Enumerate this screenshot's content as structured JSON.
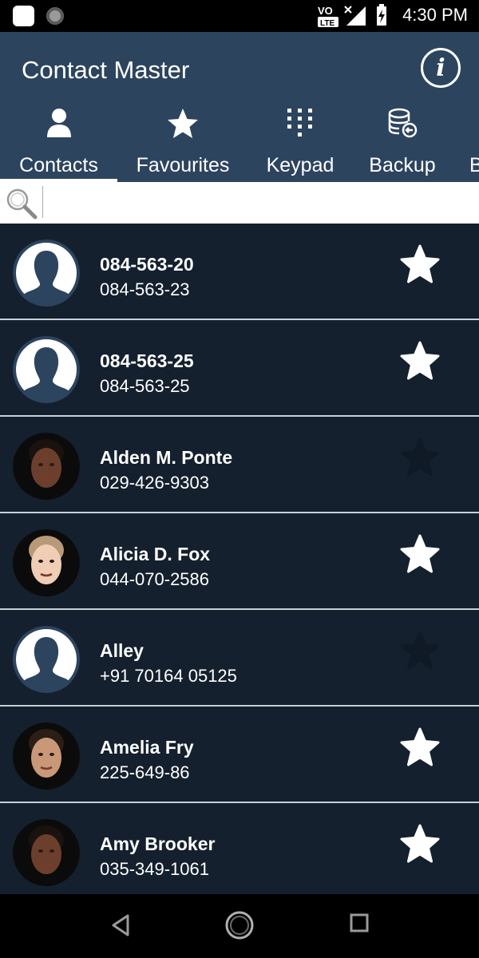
{
  "status_bar": {
    "time": "4:30 PM",
    "network_label": "VO LTE",
    "icons": [
      "app-notification-icon",
      "gear-notification-icon",
      "volte-icon",
      "signal-icon",
      "battery-charging-icon"
    ]
  },
  "header": {
    "title": "Contact Master",
    "info_icon": "info-icon"
  },
  "tabs": [
    {
      "label": "Contacts",
      "icon": "person-icon",
      "active": true
    },
    {
      "label": "Favourites",
      "icon": "star-icon",
      "active": false
    },
    {
      "label": "Keypad",
      "icon": "keypad-icon",
      "active": false
    },
    {
      "label": "Backup",
      "icon": "database-backup-icon",
      "active": false
    },
    {
      "label": "B",
      "icon": "",
      "active": false
    }
  ],
  "search": {
    "value": "",
    "placeholder": "",
    "icon": "search-icon"
  },
  "contacts": [
    {
      "name": "084-563-20",
      "phone": "084-563-23",
      "favourite": true,
      "avatar": "default"
    },
    {
      "name": "084-563-25",
      "phone": "084-563-25",
      "favourite": true,
      "avatar": "default"
    },
    {
      "name": "Alden M. Ponte",
      "phone": "029-426-9303",
      "favourite": false,
      "avatar": "photo"
    },
    {
      "name": "Alicia D. Fox",
      "phone": "044-070-2586",
      "favourite": true,
      "avatar": "photo"
    },
    {
      "name": "Alley",
      "phone": "+91 70164 05125",
      "favourite": false,
      "avatar": "default"
    },
    {
      "name": "Amelia Fry",
      "phone": "225-649-86",
      "favourite": true,
      "avatar": "photo"
    },
    {
      "name": "Amy Brooker",
      "phone": "035-349-1061",
      "favourite": true,
      "avatar": "photo"
    }
  ],
  "nav": [
    "back-icon",
    "home-icon",
    "recents-icon"
  ],
  "colors": {
    "header_bg": "#2d445f",
    "list_bg": "#14202e",
    "star_active": "#ffffff",
    "star_inactive": "#0f1a26"
  }
}
